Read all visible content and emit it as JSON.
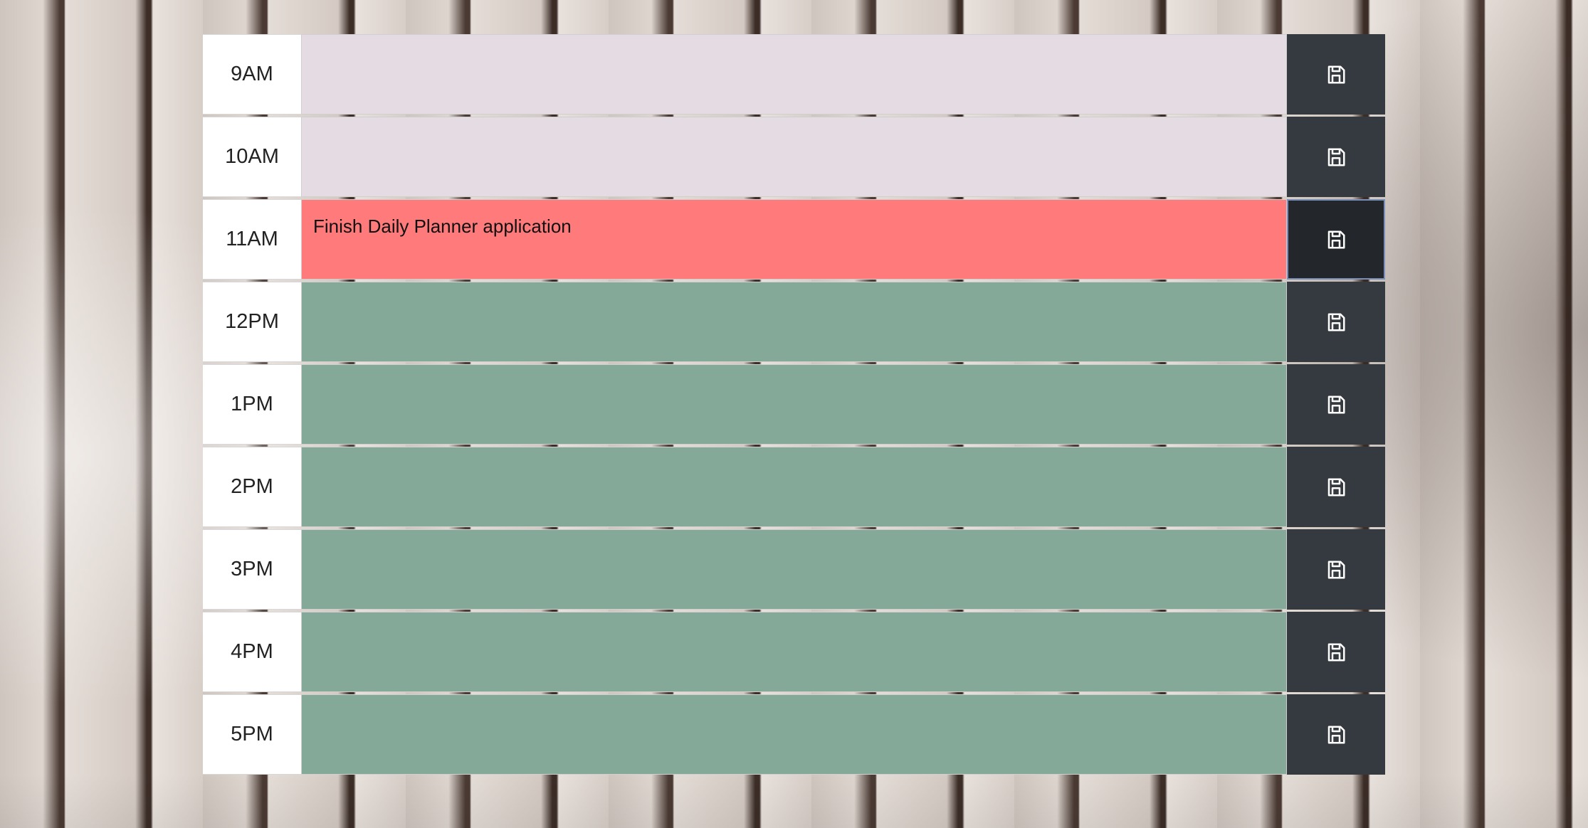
{
  "planner": {
    "rows": [
      {
        "hour": "9AM",
        "text": "",
        "state": "past"
      },
      {
        "hour": "10AM",
        "text": "",
        "state": "past"
      },
      {
        "hour": "11AM",
        "text": "Finish Daily Planner application",
        "state": "present"
      },
      {
        "hour": "12PM",
        "text": "",
        "state": "future"
      },
      {
        "hour": "1PM",
        "text": "",
        "state": "future"
      },
      {
        "hour": "2PM",
        "text": "",
        "state": "future"
      },
      {
        "hour": "3PM",
        "text": "",
        "state": "future"
      },
      {
        "hour": "4PM",
        "text": "",
        "state": "future"
      },
      {
        "hour": "5PM",
        "text": "",
        "state": "future"
      }
    ],
    "save_icon": "floppy-disk-icon",
    "colors": {
      "past": "#e5dbe2",
      "present": "#ff7b7b",
      "future": "#85a999",
      "save_button": "#343a40"
    }
  }
}
